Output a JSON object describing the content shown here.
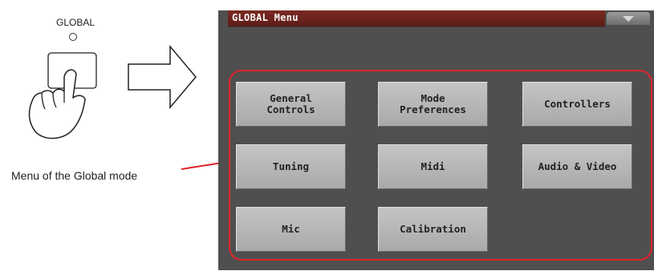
{
  "hardware": {
    "button_label": "GLOBAL"
  },
  "annotation": {
    "caption": "Menu of the Global mode",
    "highlight_color": "#e0242b"
  },
  "screen": {
    "title": "GLOBAL Menu",
    "dropdown_icon": "triangle-down",
    "buttons": [
      {
        "label": "General\nControls"
      },
      {
        "label": "Mode\nPreferences"
      },
      {
        "label": "Controllers"
      },
      {
        "label": "Tuning"
      },
      {
        "label": "Midi"
      },
      {
        "label": "Audio & Video"
      },
      {
        "label": "Mic"
      },
      {
        "label": "Calibration"
      }
    ]
  }
}
